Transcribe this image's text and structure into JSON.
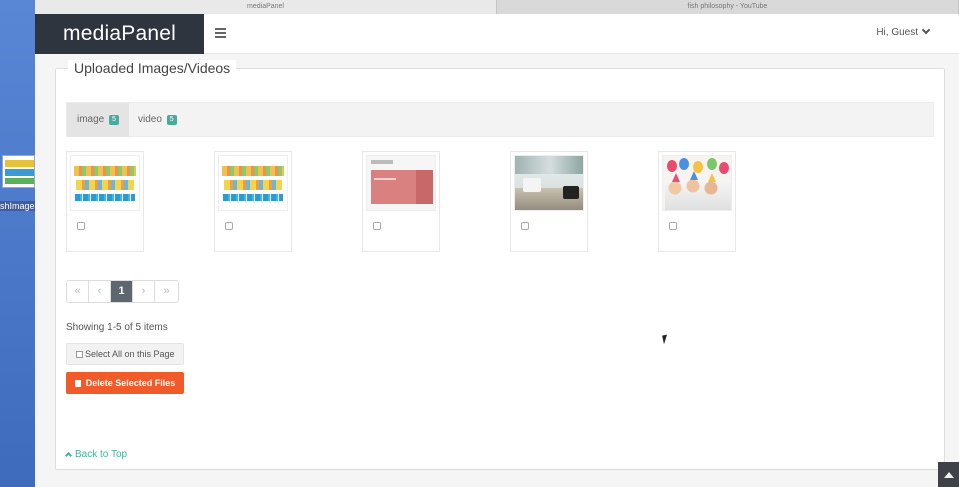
{
  "browser": {
    "tabs": [
      {
        "label": "mediaPanel",
        "active": true
      },
      {
        "label": "fish philosophy - YouTube",
        "active": false
      }
    ]
  },
  "desktop": {
    "thumb_label": "shImage"
  },
  "app": {
    "brand": "mediaPanel",
    "menu_icon": "hamburger-icon",
    "user_greeting": "Hi, Guest"
  },
  "panel": {
    "title": "Uploaded Images/Videos",
    "tabs": [
      {
        "label": "image",
        "count": "5",
        "active": true
      },
      {
        "label": "video",
        "count": "5",
        "active": false
      }
    ],
    "items": [
      {
        "kind": "poster"
      },
      {
        "kind": "poster"
      },
      {
        "kind": "slide"
      },
      {
        "kind": "photo"
      },
      {
        "kind": "party"
      }
    ],
    "pagination": {
      "first": "«",
      "prev": "‹",
      "current": "1",
      "next": "›",
      "last": "»"
    },
    "summary": "Showing 1-5 of 5 items",
    "select_all_label": "Select All on this Page",
    "delete_label": "Delete Selected Files",
    "back_to_top": "Back to Top"
  },
  "colors": {
    "brand_bg": "#2f353e",
    "badge": "#4aaa9c",
    "danger": "#f15a29",
    "link": "#3fb49d",
    "pager_active": "#5e6670"
  }
}
